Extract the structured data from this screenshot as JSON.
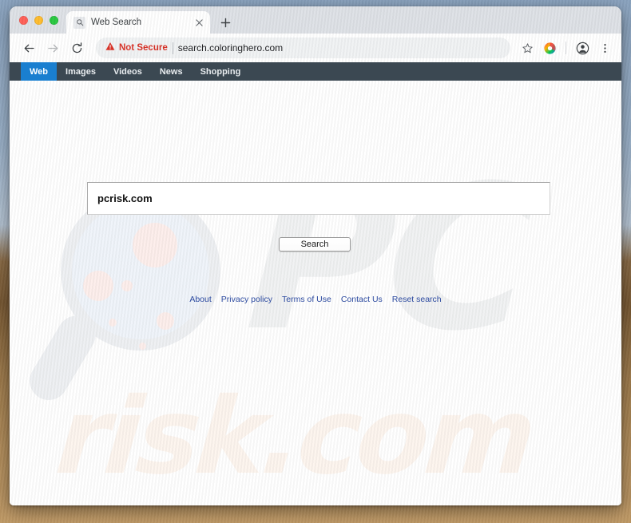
{
  "window": {
    "traffic_lights": [
      "close",
      "minimize",
      "zoom"
    ]
  },
  "browser": {
    "tab": {
      "title": "Web Search",
      "favicon": "search-icon",
      "close_label": "×"
    },
    "new_tab_label": "+",
    "toolbar": {
      "back_label": "←",
      "forward_label": "→",
      "reload_label": "⟳",
      "security_warning": "Not Secure",
      "url": "search.coloringhero.com",
      "bookmark_label": "☆",
      "extension_icon": "colored-circle-icon",
      "profile_label": "profile-avatar-icon",
      "menu_label": "⋮"
    }
  },
  "page": {
    "categories": [
      {
        "label": "Web",
        "active": true
      },
      {
        "label": "Images",
        "active": false
      },
      {
        "label": "Videos",
        "active": false
      },
      {
        "label": "News",
        "active": false
      },
      {
        "label": "Shopping",
        "active": false
      }
    ],
    "search": {
      "value": "pcrisk.com",
      "placeholder": "",
      "button_label": "Search"
    },
    "footer_links": [
      "About",
      "Privacy policy",
      "Terms of Use",
      "Contact Us",
      "Reset search"
    ],
    "watermarks": {
      "top": "PC",
      "bottom": "risk.com"
    }
  },
  "colors": {
    "nav_background": "#3b4852",
    "nav_active": "#1a7fd0",
    "link": "#2d4ba0",
    "not_secure": "#d93025",
    "watermark_grey": "#f1f2f3",
    "watermark_peach": "#fdf5ee"
  }
}
